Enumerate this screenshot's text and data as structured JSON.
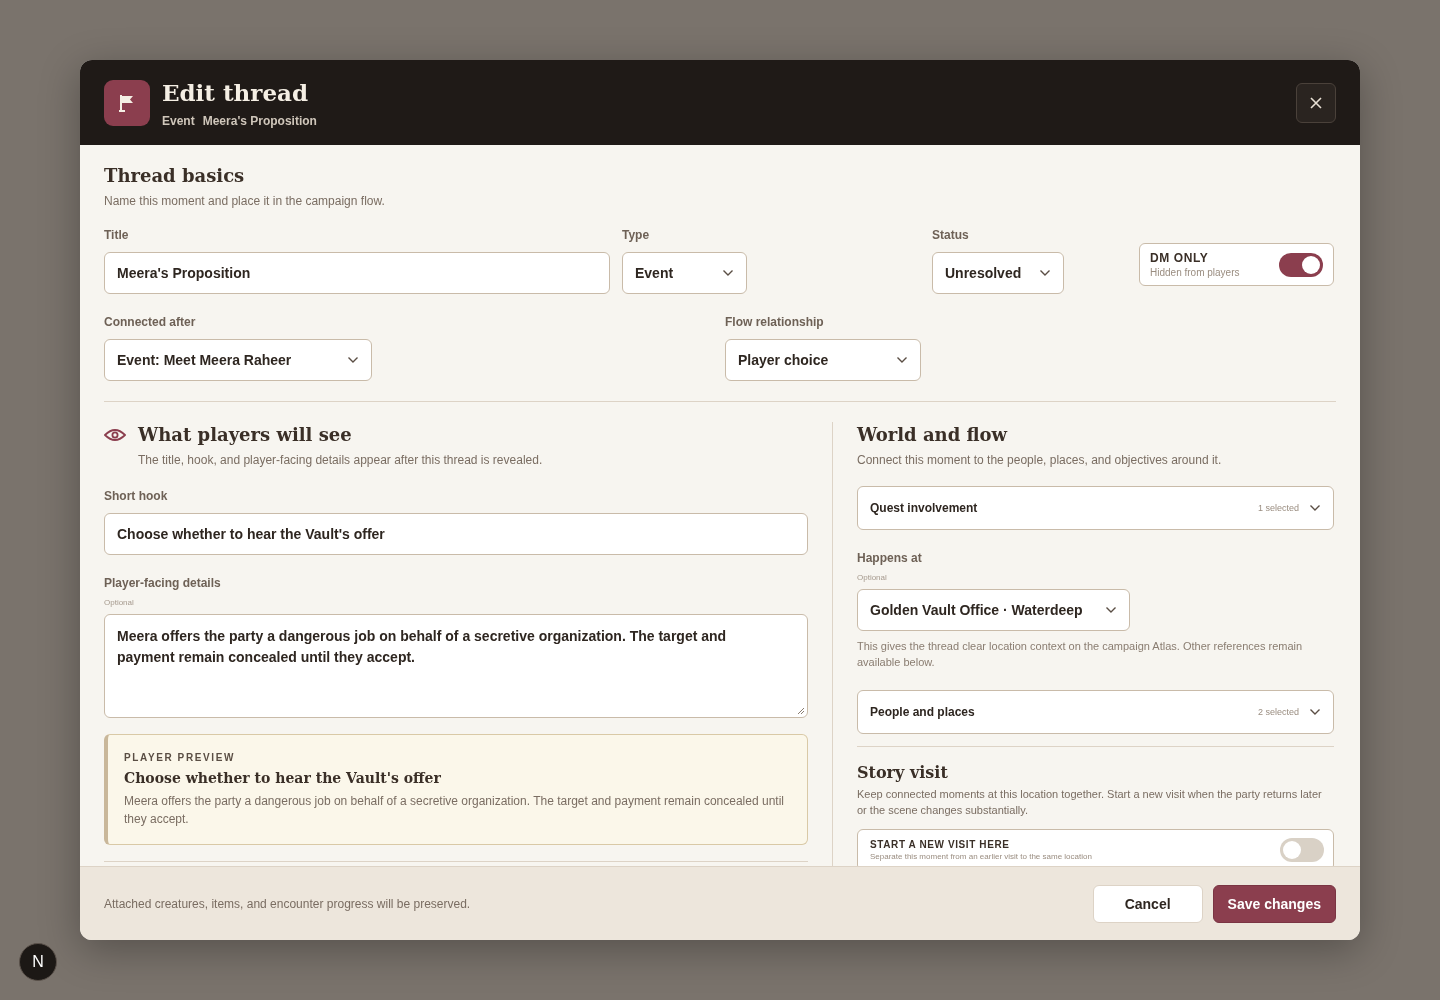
{
  "header": {
    "title": "Edit thread",
    "type": "Event",
    "name": "Meera's Proposition"
  },
  "basics": {
    "heading": "Thread basics",
    "subtitle": "Name this moment and place it in the campaign flow.",
    "row1": [
      {
        "kind": "input",
        "label": "Title",
        "value": "Meera's Proposition"
      },
      {
        "kind": "select",
        "label": "Type",
        "value": "Event"
      },
      {
        "kind": "select",
        "label": "Status",
        "value": "Unresolved"
      }
    ],
    "dm_toggle": {
      "label": "DM ONLY",
      "hint": "Hidden from players",
      "on": true
    },
    "row2": [
      {
        "kind": "select",
        "label": "Connected after",
        "value": "Event: Meet Meera Raheer"
      },
      {
        "kind": "select",
        "label": "Flow relationship",
        "value": "Player choice"
      }
    ]
  },
  "players": {
    "heading": "What players will see",
    "subtitle": "The title, hook, and player-facing details appear after this thread is revealed.",
    "short_hook": {
      "label": "Short hook",
      "value": "Choose whether to hear the Vault's offer"
    },
    "details": {
      "label": "Player-facing details",
      "optional": "Optional",
      "value": "Meera offers the party a dangerous job on behalf of a secretive organization. The target and payment remain concealed until they accept."
    },
    "preview": {
      "eyebrow": "PLAYER PREVIEW",
      "title": "Choose whether to hear the Vault's offer",
      "text": "Meera offers the party a dangerous job on behalf of a secretive organization. The target and payment remain concealed until they accept."
    }
  },
  "world": {
    "heading": "World and flow",
    "subtitle": "Connect this moment to the people, places, and objectives around it.",
    "quest": {
      "label": "Quest involvement",
      "count": "1 selected"
    },
    "happens": {
      "label": "Happens at",
      "optional": "Optional",
      "value": "Golden Vault Office · Waterdeep",
      "help": "This gives the thread clear location context on the campaign Atlas. Other references remain available below."
    },
    "people": {
      "label": "People and places",
      "count": "2 selected"
    },
    "story": {
      "heading": "Story visit",
      "text": "Keep connected moments at this location together. Start a new visit when the party returns later or the scene changes substantially.",
      "toggle": {
        "label": "START A NEW VISIT HERE",
        "hint": "Separate this moment from an earlier visit to the same location",
        "on": false
      }
    }
  },
  "footer": {
    "note": "Attached creatures, items, and encounter progress will be preserved.",
    "buttons": [
      {
        "kind": "secondary",
        "label": "Cancel"
      },
      {
        "kind": "primary",
        "label": "Save changes"
      }
    ]
  },
  "dev_badge": "N"
}
